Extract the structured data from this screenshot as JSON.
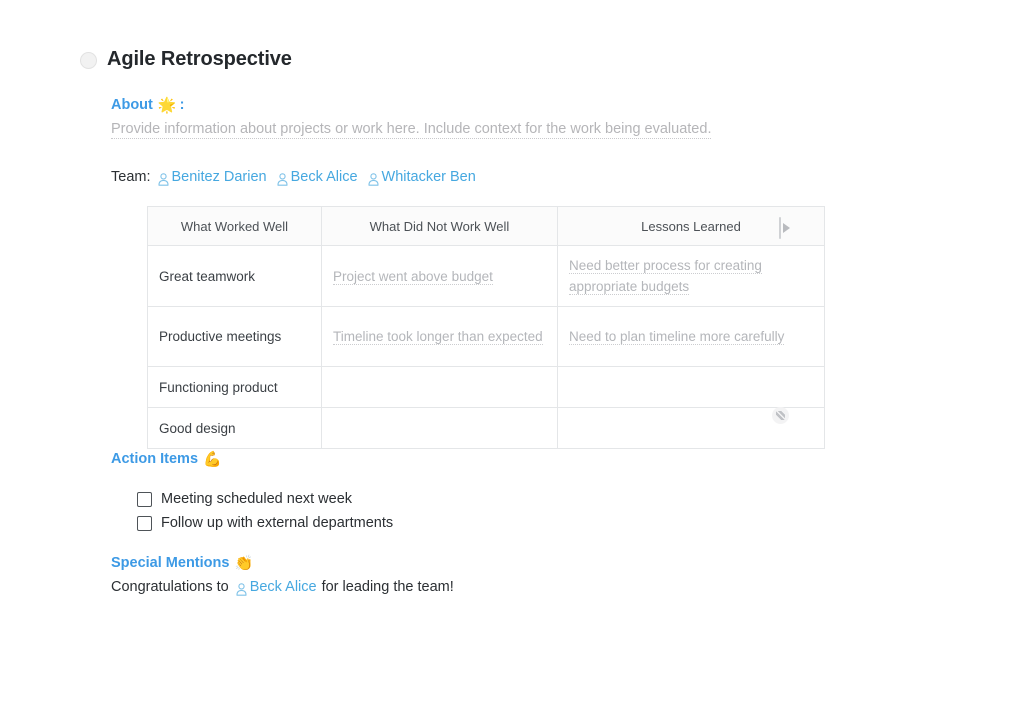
{
  "document": {
    "title": "Agile Retrospective",
    "bullet_icon": "empty-circle-icon"
  },
  "colors": {
    "heading_blue": "#3d9ae5",
    "mention_blue": "#46a8e0",
    "title_dark": "#24282c",
    "placeholder_grey": "#b5b5b8",
    "table_border": "#e4e6e8",
    "table_header_bg": "#fbfbfb"
  },
  "about": {
    "label": "About",
    "emoji": "🌟",
    "emoji_name": "glowing-star-emoji",
    "colon": ":",
    "placeholder": "Provide information about projects or work here. Include context for the work being evaluated."
  },
  "team": {
    "label": "Team:",
    "members": [
      {
        "name": "Benitez Darien",
        "icon": "person-icon"
      },
      {
        "name": "Beck Alice",
        "icon": "person-icon"
      },
      {
        "name": "Whitacker Ben",
        "icon": "person-icon"
      }
    ]
  },
  "table": {
    "headers": [
      "What Worked Well",
      "What Did Not Work Well",
      "Lessons Learned"
    ],
    "rows": [
      {
        "cells": [
          {
            "text": "Great teamwork",
            "placeholder": false
          },
          {
            "text": "Project went above budget",
            "placeholder": true
          },
          {
            "text": "Need better process for creating appropriate budgets",
            "placeholder": true
          }
        ]
      },
      {
        "cells": [
          {
            "text": "Productive meetings",
            "placeholder": false
          },
          {
            "text": "Timeline took longer than expected",
            "placeholder": true
          },
          {
            "text": "Need to plan timeline more carefully",
            "placeholder": true
          }
        ]
      },
      {
        "cells": [
          {
            "text": "Functioning product",
            "placeholder": false
          },
          {
            "text": "",
            "placeholder": false
          },
          {
            "text": "",
            "placeholder": false
          }
        ]
      },
      {
        "cells": [
          {
            "text": "Good design",
            "placeholder": false
          },
          {
            "text": "",
            "placeholder": false
          },
          {
            "text": "",
            "placeholder": false
          }
        ]
      }
    ],
    "column_add_handle_icon": "add-column-right-icon",
    "resize_handle_icon": "resize-corner-icon"
  },
  "action_items": {
    "label": "Action Items",
    "emoji": "💪",
    "emoji_name": "flexed-biceps-emoji",
    "items": [
      {
        "label": "Meeting scheduled next week",
        "checked": false
      },
      {
        "label": "Follow up with external departments",
        "checked": false
      }
    ]
  },
  "special_mentions": {
    "label": "Special Mentions",
    "emoji": "👏",
    "emoji_name": "clapping-hands-emoji",
    "prefix": "Congratulations to",
    "person": "Beck Alice",
    "person_icon": "person-icon",
    "suffix": "for leading the team!"
  }
}
